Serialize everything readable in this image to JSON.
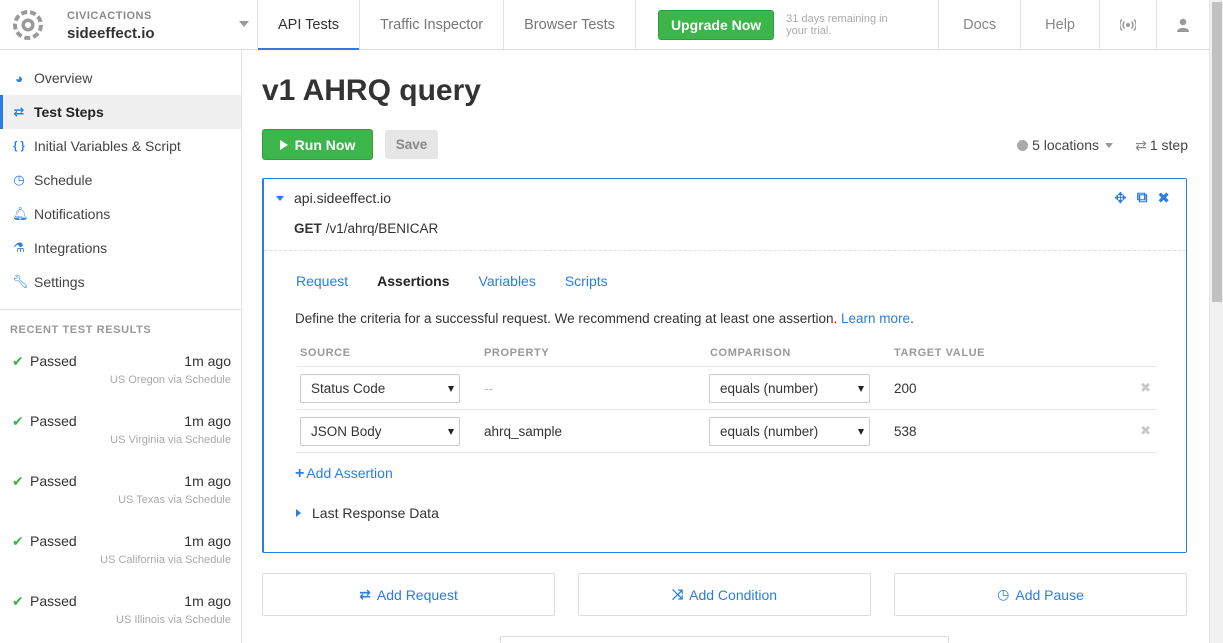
{
  "topbar": {
    "org": "CIVICACTIONS",
    "site": "sideeffect.io",
    "tabs": [
      {
        "label": "API Tests",
        "active": true
      },
      {
        "label": "Traffic Inspector",
        "active": false
      },
      {
        "label": "Browser Tests",
        "active": false
      }
    ],
    "upgrade_label": "Upgrade Now",
    "trial_note": "31 days remaining in your trial.",
    "right": {
      "docs": "Docs",
      "help": "Help"
    },
    "icons": {
      "broadcast": "broadcast-icon",
      "user": "user-icon"
    }
  },
  "sidebar": {
    "items": [
      {
        "label": "Overview",
        "icon": "dashboard-icon",
        "glyph": "◕",
        "active": false
      },
      {
        "label": "Test Steps",
        "icon": "exchange-icon",
        "glyph": "⇄",
        "active": true
      },
      {
        "label": "Initial Variables & Script",
        "icon": "braces-icon",
        "glyph": "{ }",
        "active": false
      },
      {
        "label": "Schedule",
        "icon": "clock-icon",
        "glyph": "◷",
        "active": false
      },
      {
        "label": "Notifications",
        "icon": "bell-icon",
        "glyph": "🔔︎",
        "active": false
      },
      {
        "label": "Integrations",
        "icon": "flask-icon",
        "glyph": "⚗",
        "active": false
      },
      {
        "label": "Settings",
        "icon": "wrench-icon",
        "glyph": "🔧︎",
        "active": false
      }
    ],
    "recent_heading": "RECENT TEST RESULTS",
    "results": [
      {
        "status": "Passed",
        "ago": "1m ago",
        "location": "US Oregon via Schedule"
      },
      {
        "status": "Passed",
        "ago": "1m ago",
        "location": "US Virginia via Schedule"
      },
      {
        "status": "Passed",
        "ago": "1m ago",
        "location": "US Texas via Schedule"
      },
      {
        "status": "Passed",
        "ago": "1m ago",
        "location": "US California via Schedule"
      },
      {
        "status": "Passed",
        "ago": "1m ago",
        "location": "US Illinois via Schedule"
      }
    ]
  },
  "main": {
    "title": "v1 AHRQ query",
    "run_label": "Run Now",
    "save_label": "Save",
    "locations_label": "5 locations",
    "steps_label": "1 step",
    "step": {
      "host": "api.sideeffect.io",
      "method": "GET",
      "path": "/v1/ahrq/BENICAR",
      "tabs": [
        "Request",
        "Assertions",
        "Variables",
        "Scripts"
      ],
      "active_tab": "Assertions",
      "description": "Define the criteria for a successful request. We recommend creating at least one assertion.",
      "learn_more": "Learn more",
      "columns": [
        "SOURCE",
        "PROPERTY",
        "COMPARISON",
        "TARGET VALUE"
      ],
      "assertions": [
        {
          "source": "Status Code",
          "property": "--",
          "comparison": "equals (number)",
          "target": "200"
        },
        {
          "source": "JSON Body",
          "property": "ahrq_sample",
          "comparison": "equals (number)",
          "target": "538"
        }
      ],
      "add_assertion": "Add Assertion",
      "last_response": "Last Response Data"
    },
    "actions": [
      {
        "label": "Add Request",
        "icon": "exchange-icon",
        "glyph": "⇄"
      },
      {
        "label": "Add Condition",
        "icon": "shuffle-icon",
        "glyph": "⤨"
      },
      {
        "label": "Add Pause",
        "icon": "clock-icon",
        "glyph": "◷"
      }
    ]
  }
}
